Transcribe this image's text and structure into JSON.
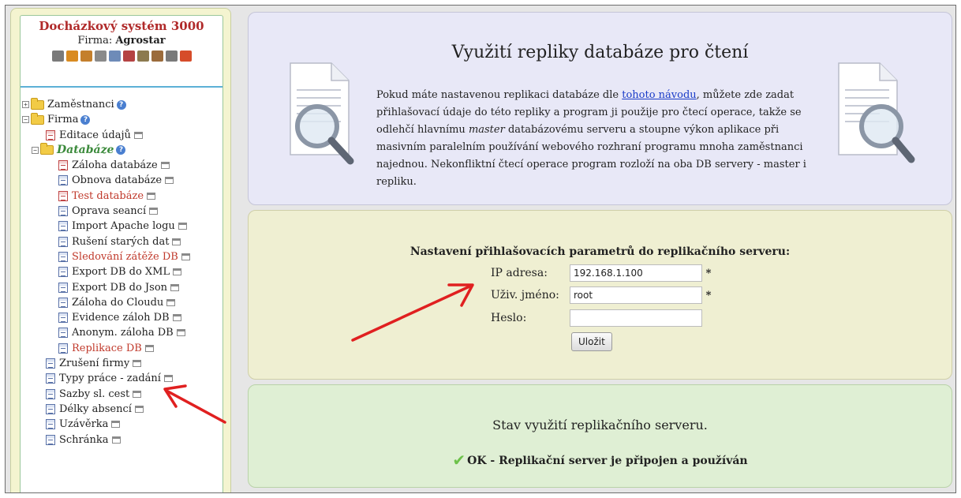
{
  "sidebar": {
    "app_title": "Docházkový systém 3000",
    "firm_label": "Firma:",
    "firm_name": "Agrostar",
    "toolbar_icons": [
      {
        "name": "search-icon",
        "color": "#7a7a7a"
      },
      {
        "name": "pencil-icon",
        "color": "#d98b21"
      },
      {
        "name": "users-icon",
        "color": "#c47f2c"
      },
      {
        "name": "key-icon",
        "color": "#8a8a8a"
      },
      {
        "name": "report-icon",
        "color": "#6e8bb8"
      },
      {
        "name": "book-icon",
        "color": "#b54343"
      },
      {
        "name": "building-icon",
        "color": "#8c7a4f"
      },
      {
        "name": "home-icon",
        "color": "#9b6b3b"
      },
      {
        "name": "print-icon",
        "color": "#7a7a7a"
      },
      {
        "name": "power-icon",
        "color": "#d64c2a"
      }
    ],
    "tree": {
      "employees": "Zaměstnanci",
      "firm": "Firma",
      "edit_data": "Editace údajů",
      "databases": "Databáze",
      "db_items": [
        "Záloha databáze",
        "Obnova databáze",
        "Test databáze",
        "Oprava seancí",
        "Import Apache logu",
        "Rušení starých dat",
        "Sledování zátěže DB",
        "Export DB do XML",
        "Export DB do Json",
        "Záloha do Cloudu",
        "Evidence záloh DB",
        "Anonym. záloha DB",
        "Replikace DB"
      ],
      "firm_items": [
        "Zrušení firmy",
        "Typy práce - zadání",
        "Sazby sl. cest",
        "Délky absencí",
        "Uzávěrka",
        "Schránka"
      ]
    }
  },
  "intro": {
    "title": "Využití repliky databáze pro čtení",
    "text_before_link": "Pokud máte nastavenou replikaci databáze dle ",
    "link_text": "tohoto návodu",
    "text_part2": ", můžete zde zadat přihlašovací údaje do této repliky a program ji použije pro čtecí operace, takže se odlehčí hlavnímu ",
    "master_word": "master",
    "text_part3": " databázovému serveru a stoupne výkon aplikace při masivním paralelním používání webového rozhraní programu mnoha zaměstnanci najednou. Nekonfliktní čtecí operace program rozloží na oba DB servery - master i repliku."
  },
  "form": {
    "title": "Nastavení přihlašovacích parametrů do replikačního serveru:",
    "ip_label": "IP adresa:",
    "ip_value": "192.168.1.100",
    "user_label": "Uživ. jméno:",
    "user_value": "root",
    "password_label": "Heslo:",
    "password_value": "",
    "required_mark": "*",
    "save_label": "Uložit"
  },
  "status": {
    "title": "Stav využití replikačního serveru.",
    "message": "OK - Replikační server je připojen a používán"
  },
  "colors": {
    "accent_red": "#c0392b",
    "arrow_red": "#e02020",
    "ok_green": "#6dc24a"
  }
}
